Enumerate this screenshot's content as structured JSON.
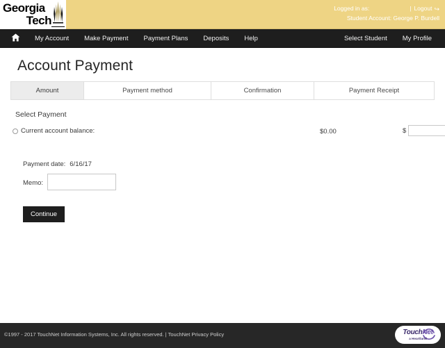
{
  "masthead": {
    "logo_line1": "Georgia",
    "logo_line2": "Tech",
    "logo_icon": "georgia-tech-tower-icon",
    "logged_in_as_label": "Logged in as:",
    "logged_in_as_value": "",
    "separator": "|",
    "logout_label": "Logout",
    "logout_icon": "logout-icon",
    "student_account_line": "Student Account: George P. Burdell",
    "gold_color": "#eed484"
  },
  "nav": {
    "home_icon": "home-icon",
    "left_items": [
      {
        "label": "My Account"
      },
      {
        "label": "Make Payment"
      },
      {
        "label": "Payment Plans"
      },
      {
        "label": "Deposits"
      },
      {
        "label": "Help"
      }
    ],
    "right_items": [
      {
        "label": "Select Student"
      },
      {
        "label": "My Profile"
      }
    ],
    "bar_color": "#1e1e1e"
  },
  "page": {
    "title": "Account Payment"
  },
  "steps": [
    {
      "label": "Amount",
      "active": true
    },
    {
      "label": "Payment method",
      "active": false
    },
    {
      "label": "Confirmation",
      "active": false
    },
    {
      "label": "Payment Receipt",
      "active": false
    }
  ],
  "form": {
    "section_label": "Select Payment",
    "balance_option_label": "Current account balance:",
    "balance_amount": "$0.00",
    "currency_symbol": "$",
    "amount_value": "",
    "amount_placeholder": "",
    "payment_date_label": "Payment date:",
    "payment_date_value": "6/16/17",
    "memo_label": "Memo:",
    "memo_value": "",
    "memo_placeholder": "",
    "continue_label": "Continue"
  },
  "footer": {
    "copyright": "©1997 - 2017  TouchNet Information Systems, Inc. All rights reserved.",
    "separator": "|",
    "privacy_link": "TouchNet Privacy Policy",
    "logo_text_touch": "Touch",
    "logo_text_net": "Net",
    "logo_subtitle": "a Heartland",
    "logo_icon": "touchnet-logo",
    "bar_color": "#272727"
  }
}
